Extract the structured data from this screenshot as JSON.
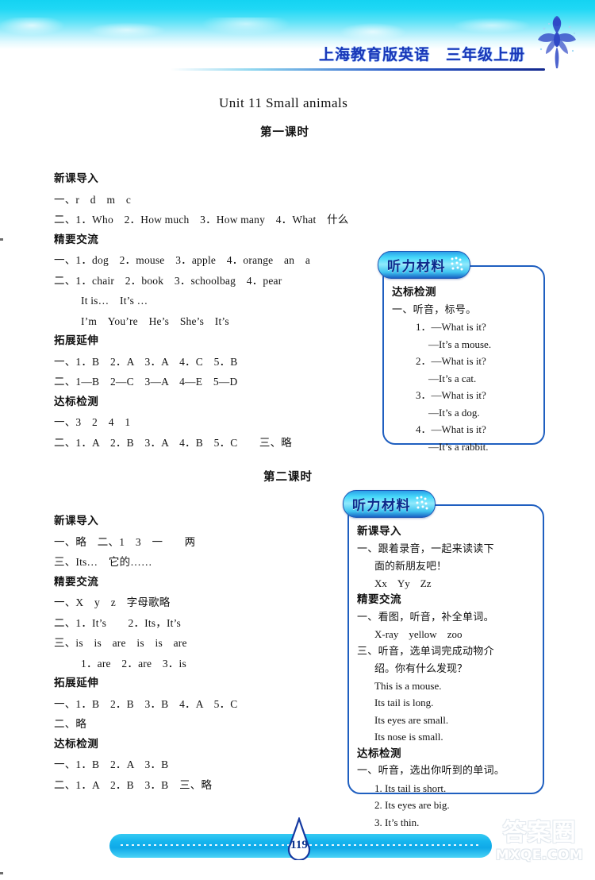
{
  "header": {
    "title": "上海教育版英语　三年级上册",
    "fairy_icon": "fairy-icon"
  },
  "page": {
    "unit_title": "Unit 11 Small animals",
    "period_1": "第一课时",
    "period_2": "第二课时"
  },
  "period1_answers": [
    {
      "type": "head",
      "text": "新课导入"
    },
    {
      "type": "line",
      "text": "一、r　d　m　c"
    },
    {
      "type": "line",
      "text": "二、1．Who　2．How much　3．How many　4．What　什么"
    },
    {
      "type": "head",
      "text": "精要交流"
    },
    {
      "type": "line",
      "text": "一、1．dog　2．mouse　3．apple　4．orange　an　a"
    },
    {
      "type": "line",
      "text": "二、1．chair　2．book　3．schoolbag　4．pear"
    },
    {
      "type": "indent",
      "text": "It is…　It’s …"
    },
    {
      "type": "indent",
      "text": "I’m　You’re　He’s　She’s　It’s"
    },
    {
      "type": "head",
      "text": "拓展延伸"
    },
    {
      "type": "line",
      "text": "一、1．B　2．A　3．A　4．C　5．B"
    },
    {
      "type": "line",
      "text": "二、1—B　2—C　3—A　4—E　5—D"
    },
    {
      "type": "head",
      "text": "达标检测"
    },
    {
      "type": "line",
      "text": "一、3　2　4　1"
    },
    {
      "type": "line",
      "text": "二、1．A　2．B　3．A　4．B　5．C　　三、略"
    }
  ],
  "period2_answers": [
    {
      "type": "head",
      "text": "新课导入"
    },
    {
      "type": "line",
      "text": "一、略　二、1　3　一　　两"
    },
    {
      "type": "line",
      "text": "三、Its…　它的……"
    },
    {
      "type": "head",
      "text": "精要交流"
    },
    {
      "type": "line",
      "text": "一、X　y　z　字母歌略"
    },
    {
      "type": "line",
      "text": "二、1．It’s　　2．Its，It’s"
    },
    {
      "type": "line",
      "text": "三、is　is　are　is　is　are"
    },
    {
      "type": "indent",
      "text": "1．are　2．are　3．is"
    },
    {
      "type": "head",
      "text": "拓展延伸"
    },
    {
      "type": "line",
      "text": "一、1．B　2．B　3．B　4．A　5．C"
    },
    {
      "type": "line",
      "text": "二、略"
    },
    {
      "type": "head",
      "text": "达标检测"
    },
    {
      "type": "line",
      "text": "一、1．B　2．A　3．B"
    },
    {
      "type": "line",
      "text": "二、1．A　2．B　3．B　三、略"
    }
  ],
  "listening_box_1": {
    "tab_label": "听力材料",
    "lines": [
      {
        "type": "head",
        "text": "达标检测"
      },
      {
        "type": "cn",
        "text": "一、听音，标号。"
      },
      {
        "type": "i1",
        "text": "1．—What is it?"
      },
      {
        "type": "i2",
        "text": "—It’s a mouse."
      },
      {
        "type": "i1",
        "text": "2．—What is it?"
      },
      {
        "type": "i2",
        "text": "—It’s a cat."
      },
      {
        "type": "i1",
        "text": "3．—What is it?"
      },
      {
        "type": "i2",
        "text": "—It’s a dog."
      },
      {
        "type": "i1",
        "text": "4．—What is it?"
      },
      {
        "type": "i2",
        "text": "—It’s a rabbit."
      }
    ]
  },
  "listening_box_2": {
    "tab_label": "听力材料",
    "lines": [
      {
        "type": "head",
        "text": "新课导入"
      },
      {
        "type": "cn",
        "text": "一、跟着录音，一起来读读下"
      },
      {
        "type": "i3",
        "text": "面的新朋友吧！"
      },
      {
        "type": "i3",
        "text": "Xx　Yy　Zz"
      },
      {
        "type": "head",
        "text": "精要交流"
      },
      {
        "type": "cn",
        "text": "一、看图，听音，补全单词。"
      },
      {
        "type": "i3",
        "text": "X-ray　yellow　zoo"
      },
      {
        "type": "cn",
        "text": "三、听音，选单词完成动物介"
      },
      {
        "type": "i3",
        "text": "绍。你有什么发现？"
      },
      {
        "type": "i3",
        "text": "This is a mouse."
      },
      {
        "type": "i3",
        "text": "Its tail is long."
      },
      {
        "type": "i3",
        "text": "Its eyes are small."
      },
      {
        "type": "i3",
        "text": "Its nose is small."
      },
      {
        "type": "head",
        "text": "达标检测"
      },
      {
        "type": "cn",
        "text": "一、听音，选出你听到的单词。"
      },
      {
        "type": "i3",
        "text": "1. Its tail is short."
      },
      {
        "type": "i3",
        "text": "2. Its eyes are big."
      },
      {
        "type": "i3",
        "text": "3. It’s thin."
      }
    ]
  },
  "footer": {
    "page_number": "119",
    "watermark_cn": "答案圈",
    "watermark_en": "MXQE.COM"
  },
  "colors": {
    "banner_cyan": "#14d3f2",
    "title_blue": "#1a37b8",
    "box_border": "#1f5fc0",
    "tab_gradient_top": "#45d8fa",
    "tab_gradient_bottom": "#1a63c4",
    "footer_bar": "#17b6ee"
  }
}
